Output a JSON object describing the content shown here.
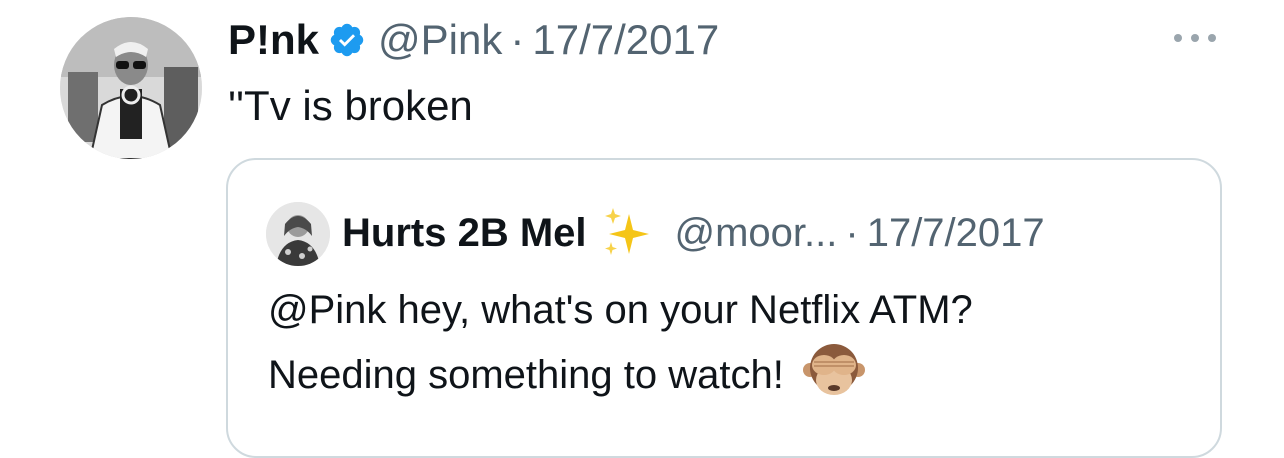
{
  "tweet": {
    "author": {
      "display_name": "P!nk",
      "handle": "@Pink",
      "verified": true
    },
    "separator": "·",
    "date": "17/7/2017",
    "text": "''Tv is broken",
    "more_icon": "more-horizontal-icon",
    "quoted": {
      "display_name": "Hurts 2B Mel",
      "name_emoji": "sparkles",
      "handle": "@moor...",
      "separator": "·",
      "date": "17/7/2017",
      "text_line1": "@Pink hey, what's on your Netflix ATM?",
      "text_line2": "Needing something to watch!",
      "trailing_emoji": "see-no-evil-monkey"
    }
  },
  "colors": {
    "text": "#0f1419",
    "muted": "#536471",
    "verified_blue": "#1d9bf0",
    "border": "#cfd9de",
    "sparkle_gold": "#f5c518"
  }
}
